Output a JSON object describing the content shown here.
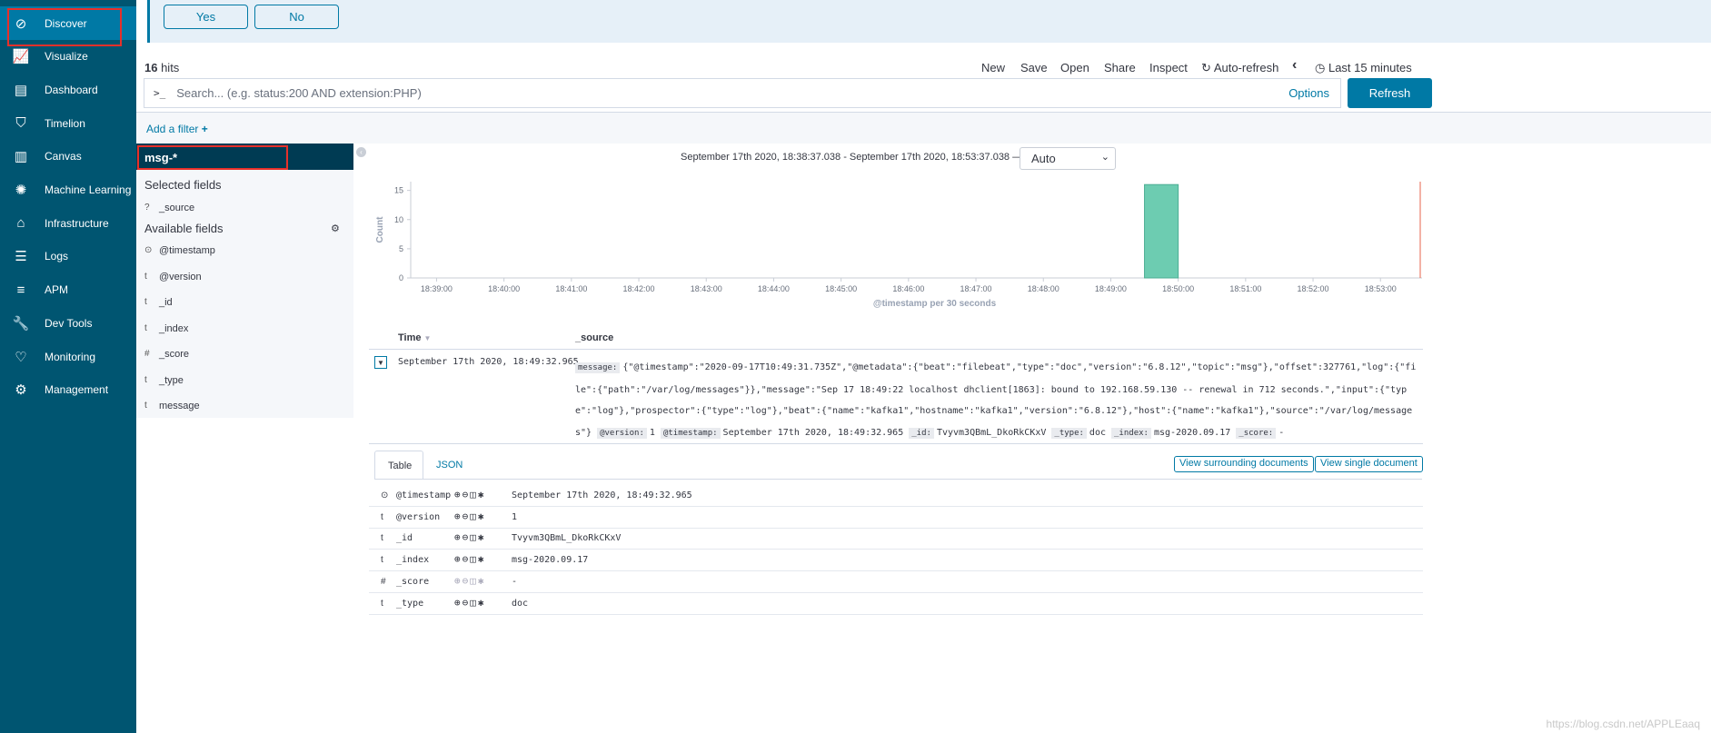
{
  "sidebar": {
    "items": [
      {
        "label": "Discover",
        "icon": "compass-icon",
        "glyph": "⊘",
        "active": true
      },
      {
        "label": "Visualize",
        "icon": "visualize-icon",
        "glyph": "📈"
      },
      {
        "label": "Dashboard",
        "icon": "dashboard-icon",
        "glyph": "▤"
      },
      {
        "label": "Timelion",
        "icon": "timelion-icon",
        "glyph": "⛉"
      },
      {
        "label": "Canvas",
        "icon": "canvas-icon",
        "glyph": "▥"
      },
      {
        "label": "Machine Learning",
        "icon": "machine-learning-icon",
        "glyph": "✺"
      },
      {
        "label": "Infrastructure",
        "icon": "infrastructure-icon",
        "glyph": "⌂"
      },
      {
        "label": "Logs",
        "icon": "logs-icon",
        "glyph": "☰"
      },
      {
        "label": "APM",
        "icon": "apm-icon",
        "glyph": "≡"
      },
      {
        "label": "Dev Tools",
        "icon": "wrench-icon",
        "glyph": "🔧"
      },
      {
        "label": "Monitoring",
        "icon": "heartbeat-icon",
        "glyph": "♡"
      },
      {
        "label": "Management",
        "icon": "gear-icon",
        "glyph": "⚙"
      }
    ]
  },
  "confirm": {
    "yes": "Yes",
    "no": "No"
  },
  "hits": {
    "count": "16",
    "label": " hits"
  },
  "topnav": {
    "new": "New",
    "save": "Save",
    "open": "Open",
    "share": "Share",
    "inspect": "Inspect",
    "auto_refresh": "Auto-refresh",
    "back": "‹",
    "time": "Last 15 minutes"
  },
  "search": {
    "prompt": ">_",
    "placeholder": "Search... (e.g. status:200 AND extension:PHP)",
    "options": "Options",
    "refresh": "Refresh"
  },
  "filter": {
    "add": "Add a filter",
    "plus": "+"
  },
  "fields_panel": {
    "index_pattern": "msg-*",
    "selected_heading": "Selected fields",
    "selected": [
      {
        "type": "?",
        "name": "_source"
      }
    ],
    "available_heading": "Available fields",
    "available": [
      {
        "type": "⊙",
        "name": "@timestamp"
      },
      {
        "type": "t",
        "name": "@version"
      },
      {
        "type": "t",
        "name": "_id"
      },
      {
        "type": "t",
        "name": "_index"
      },
      {
        "type": "#",
        "name": "_score"
      },
      {
        "type": "t",
        "name": "_type"
      },
      {
        "type": "t",
        "name": "message"
      }
    ]
  },
  "time_range": "September 17th 2020, 18:38:37.038 - September 17th 2020, 18:53:37.038 —",
  "interval": "Auto",
  "chart_data": {
    "type": "bar",
    "xlabel": "@timestamp per 30 seconds",
    "ylabel": "Count",
    "x_range": [
      "18:38:37",
      "18:53:37"
    ],
    "ylim": [
      0,
      16.5
    ],
    "yticks": [
      0,
      5,
      10,
      15
    ],
    "xticks": [
      "18:39:00",
      "18:40:00",
      "18:41:00",
      "18:42:00",
      "18:43:00",
      "18:44:00",
      "18:45:00",
      "18:46:00",
      "18:47:00",
      "18:48:00",
      "18:49:00",
      "18:50:00",
      "18:51:00",
      "18:52:00",
      "18:53:00"
    ],
    "bars": [
      {
        "start": "18:49:30",
        "end": "18:50:00",
        "value": 16
      }
    ],
    "bar_color": "#6dccb1",
    "now_marker": "18:53:37",
    "now_color": "#e7664c"
  },
  "doc_table": {
    "time_header": "Time",
    "source_header": "_source",
    "row": {
      "time": "September 17th 2020, 18:49:32.965",
      "message_key": "message:",
      "message": "{\"@timestamp\":\"2020-09-17T10:49:31.735Z\",\"@metadata\":{\"beat\":\"filebeat\",\"type\":\"doc\",\"version\":\"6.8.12\",\"topic\":\"msg\"},\"offset\":327761,\"log\":{\"file\":{\"path\":\"/var/log/messages\"}},\"message\":\"Sep 17 18:49:22 localhost dhclient[1863]: bound to 192.168.59.130 -- renewal in 712 seconds.\",\"input\":{\"type\":\"log\"},\"prospector\":{\"type\":\"log\"},\"beat\":{\"name\":\"kafka1\",\"hostname\":\"kafka1\",\"version\":\"6.8.12\"},\"host\":{\"name\":\"kafka1\"},\"source\":\"/var/log/messages\"}",
      "version_key": "@version:",
      "version": "1",
      "timestamp_key": "@timestamp:",
      "timestamp": "September 17th 2020, 18:49:32.965",
      "id_key": "_id:",
      "id": "Tvyvm3QBmL_DkoRkCKxV",
      "type_key": "_type:",
      "type": "doc",
      "index_key": "_index:",
      "index": "msg-2020.09.17",
      "score_key": "_score:",
      "score": "-"
    }
  },
  "detail": {
    "tabs": [
      "Table",
      "JSON"
    ],
    "surrounding": "View surrounding documents",
    "single": "View single document",
    "rows": [
      {
        "type": "⊙",
        "name": "@timestamp",
        "value": "September 17th 2020, 18:49:32.965"
      },
      {
        "type": "t",
        "name": "@version",
        "value": "1"
      },
      {
        "type": "t",
        "name": "_id",
        "value": "Tvyvm3QBmL_DkoRkCKxV"
      },
      {
        "type": "t",
        "name": "_index",
        "value": "msg-2020.09.17"
      },
      {
        "type": "#",
        "name": "_score",
        "value": "-"
      },
      {
        "type": "t",
        "name": "_type",
        "value": "doc"
      }
    ],
    "actions": "⊕⊖◫✱"
  },
  "watermark": "https://blog.csdn.net/APPLEaaq"
}
